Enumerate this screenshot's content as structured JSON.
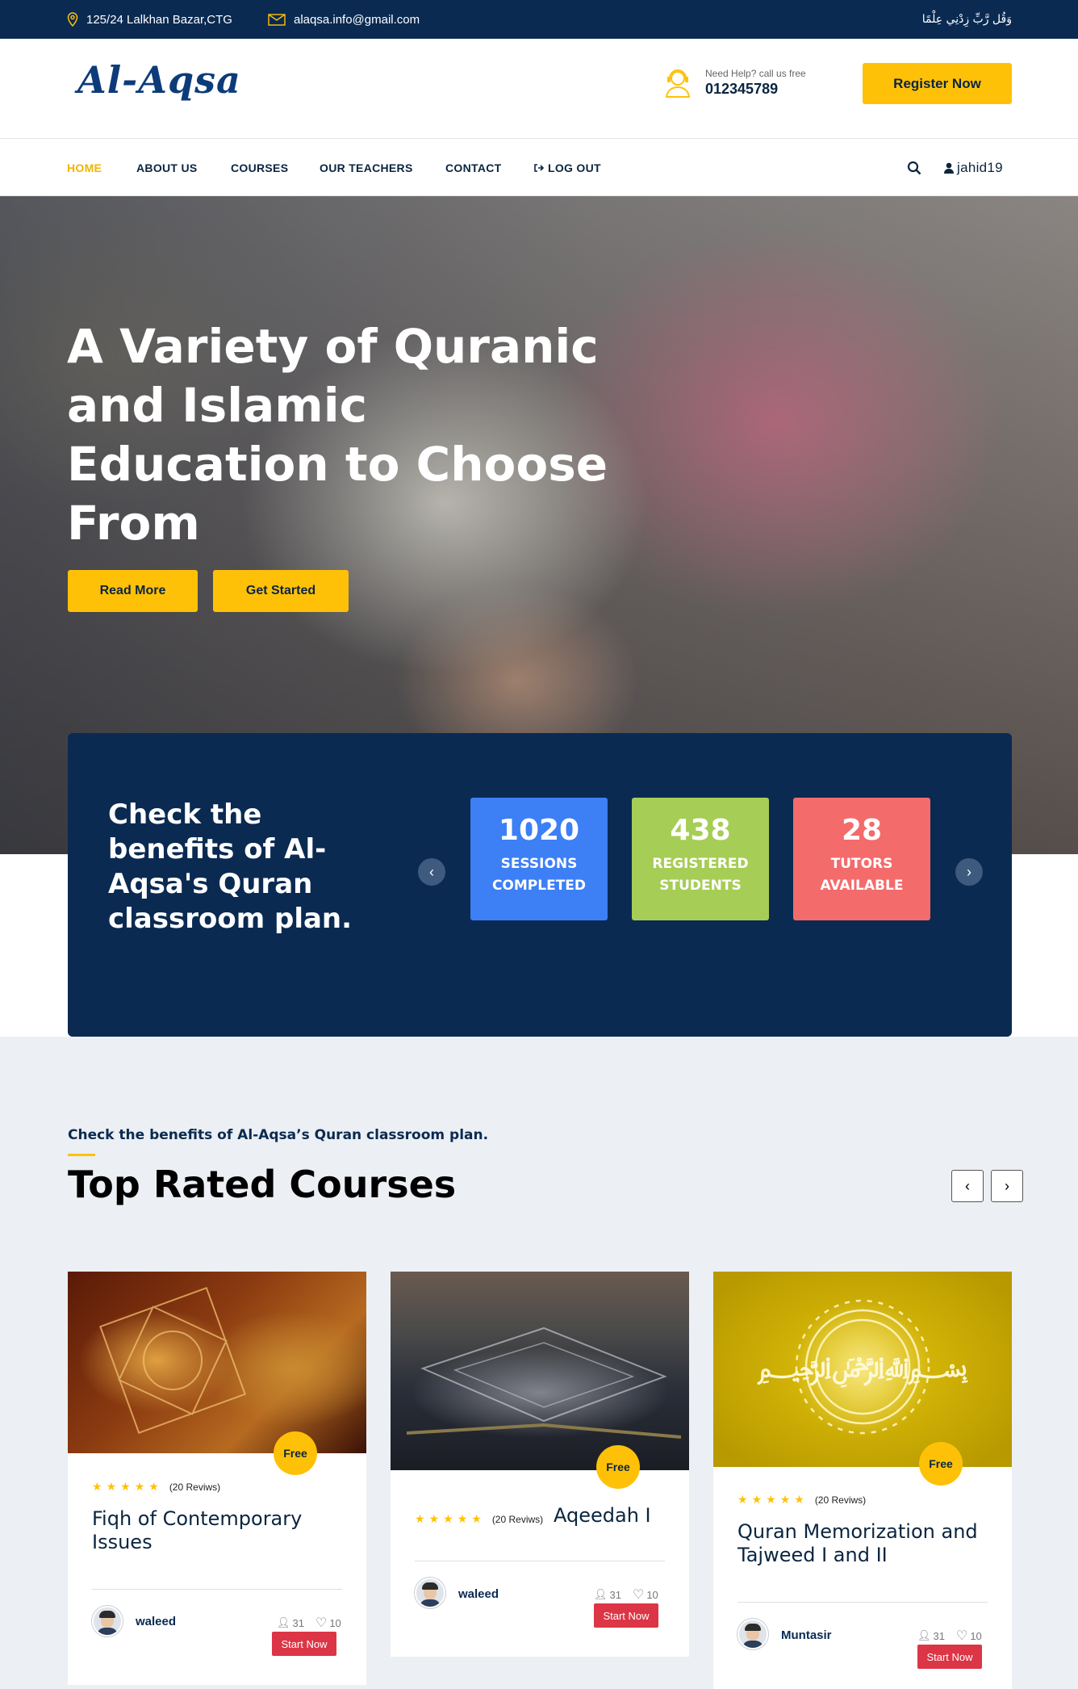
{
  "topbar": {
    "address": "125/24 Lalkhan Bazar,CTG",
    "email": "alaqsa.info@gmail.com",
    "arabic_verse": "وَقُل رَّبِّ زِدْنِي عِلْمًا"
  },
  "header": {
    "logo": "Al-Aqsa",
    "help_text": "Need Help? call us free",
    "phone": "012345789",
    "register_label": "Register Now"
  },
  "nav": {
    "items": [
      "HOME",
      "ABOUT US",
      "COURSES",
      "OUR TEACHERS",
      "CONTACT",
      "LOG OUT"
    ],
    "active": "HOME",
    "username": "jahid19"
  },
  "hero": {
    "title": "A Variety of Quranic and Islamic Education to Choose From",
    "read_more": "Read More",
    "get_started": "Get Started"
  },
  "stats": {
    "heading": "Check the benefits of Al-Aqsa's Quran classroom plan.",
    "items": [
      {
        "value": "1020",
        "label": "SESSIONS COMPLETED",
        "color": "#3d7ff5"
      },
      {
        "value": "438",
        "label": "REGISTERED STUDENTS",
        "color": "#a6cd56"
      },
      {
        "value": "28",
        "label": "TUTORS AVAILABLE",
        "color": "#f36b6b"
      }
    ]
  },
  "courses": {
    "subtitle": "Check the benefits of Al-Aqsa’s Quran classroom plan.",
    "title": "Top Rated Courses",
    "items": [
      {
        "title": "Fiqh of Contemporary Issues",
        "badge": "Free",
        "reviews": "(20 Reviws)",
        "rating": 5,
        "author": "waleed",
        "students": "31",
        "likes": "10",
        "button": "Start Now"
      },
      {
        "title": "Aqeedah I",
        "badge": "Free",
        "reviews": "(20 Reviws)",
        "rating": 5,
        "author": "waleed",
        "students": "31",
        "likes": "10",
        "button": "Start Now"
      },
      {
        "title": "Quran Memorization and Tajweed I and II",
        "badge": "Free",
        "reviews": "(20 Reviws)",
        "rating": 5,
        "author": "Muntasir",
        "students": "31",
        "likes": "10",
        "button": "Start Now"
      }
    ]
  },
  "colors": {
    "navy": "#0a2a52",
    "accent": "#ffc107",
    "danger": "#dc3545"
  }
}
